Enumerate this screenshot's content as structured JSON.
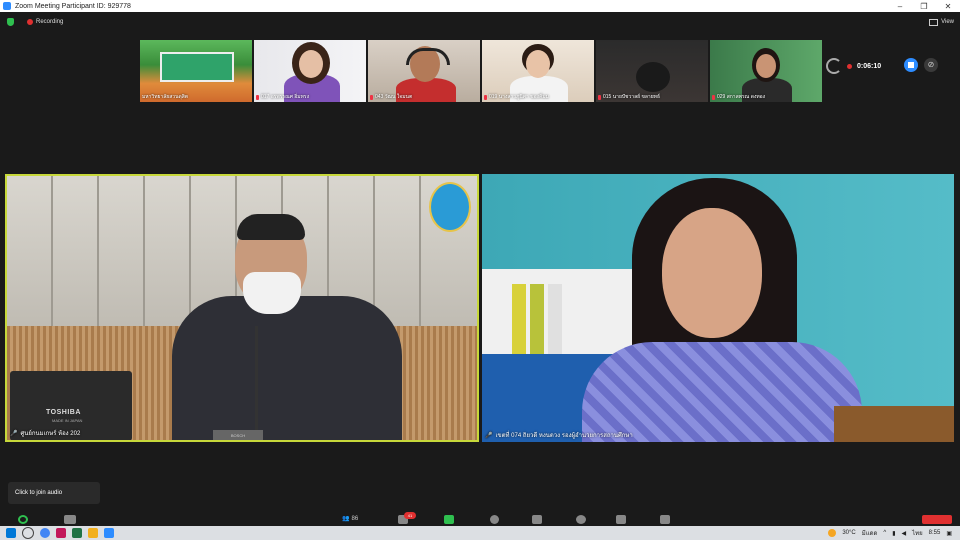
{
  "window": {
    "title": "Zoom Meeting Participant ID: 929778",
    "minimize": "–",
    "maximize": "❐",
    "close": "✕"
  },
  "recording": {
    "label": "Recording"
  },
  "view": {
    "label": "View"
  },
  "thumbnails": [
    {
      "name": "มหาวิทยาลัยสวนดุสิต"
    },
    {
      "name": "017 อรพรรณศ อิ่มทรง"
    },
    {
      "name": "043 วัฒน ใจมนต"
    },
    {
      "name": "019 นางสาวภูนิศา ของคิ่มม"
    },
    {
      "name": "015 นายปัชวาลย์ ขลายทธ์"
    },
    {
      "name": "029 สกาลพรณ ดงทอง"
    }
  ],
  "timer": {
    "value": "0:06:10"
  },
  "main_videos": {
    "left": {
      "name": "ศูนย์กนมเกษร์ ห้อง 202",
      "laptop_brand": "TOSHIBA",
      "laptop_sub": "MADE IN JAPAN",
      "mic_brand": "BOSCH"
    },
    "right": {
      "name": "เขตที่ 074 ถิยวดี หงนดวง รองผู้อำนวยการสถานศึกษา"
    }
  },
  "audio_tip": {
    "label": "Click to join audio"
  },
  "toolbar": {
    "participants_count": "86",
    "chat_badge": "41"
  },
  "taskbar": {
    "temperature": "30°C",
    "weather": "มีแดด",
    "language": "ไทย",
    "time": "8:55"
  }
}
